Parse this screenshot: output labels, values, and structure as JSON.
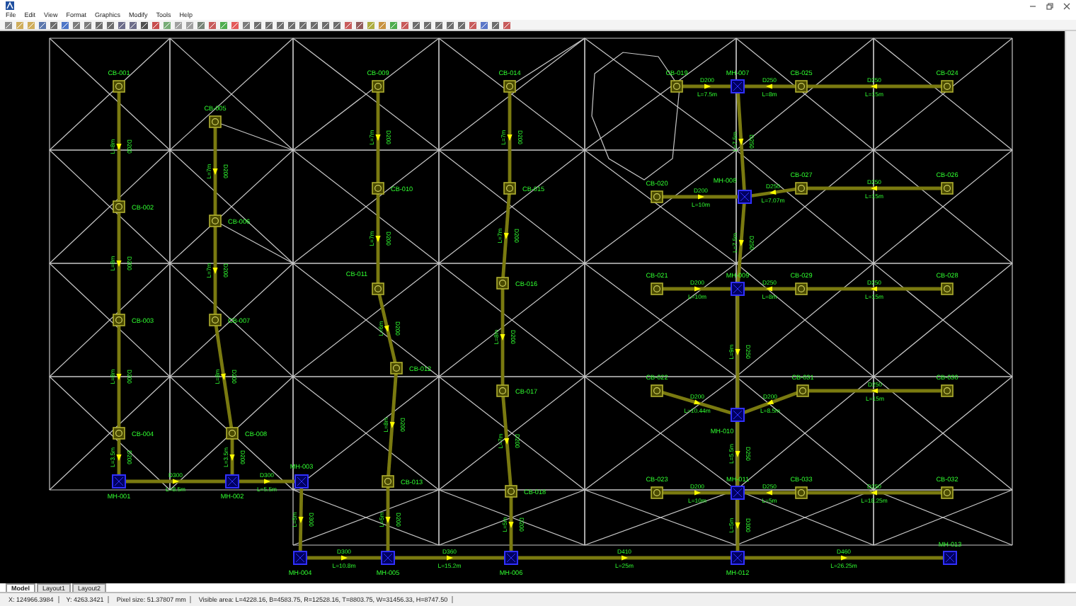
{
  "menu": [
    "File",
    "Edit",
    "View",
    "Format",
    "Graphics",
    "Modify",
    "Tools",
    "Help"
  ],
  "nodes": [
    {
      "label": "CB-001",
      "kind": "catch_basin"
    },
    {
      "label": "CB-002",
      "kind": "catch_basin"
    },
    {
      "label": "CB-003",
      "kind": "catch_basin"
    },
    {
      "label": "CB-004",
      "kind": "catch_basin"
    },
    {
      "label": "MH-001",
      "kind": "manhole"
    },
    {
      "label": "CB-005",
      "kind": "catch_basin"
    },
    {
      "label": "CB-006",
      "kind": "catch_basin"
    },
    {
      "label": "CB-007",
      "kind": "catch_basin"
    },
    {
      "label": "CB-008",
      "kind": "catch_basin"
    },
    {
      "label": "MH-002",
      "kind": "manhole"
    },
    {
      "label": "MH-003",
      "kind": "manhole"
    },
    {
      "label": "MH-004",
      "kind": "manhole"
    },
    {
      "label": "CB-009",
      "kind": "catch_basin"
    },
    {
      "label": "CB-010",
      "kind": "catch_basin"
    },
    {
      "label": "CB-011",
      "kind": "catch_basin"
    },
    {
      "label": "CB-012",
      "kind": "catch_basin"
    },
    {
      "label": "CB-013",
      "kind": "catch_basin"
    },
    {
      "label": "MH-005",
      "kind": "manhole"
    },
    {
      "label": "CB-014",
      "kind": "catch_basin"
    },
    {
      "label": "CB-015",
      "kind": "catch_basin"
    },
    {
      "label": "CB-016",
      "kind": "catch_basin"
    },
    {
      "label": "CB-017",
      "kind": "catch_basin"
    },
    {
      "label": "CB-018",
      "kind": "catch_basin"
    },
    {
      "label": "MH-006",
      "kind": "manhole"
    },
    {
      "label": "CB-019",
      "kind": "catch_basin"
    },
    {
      "label": "MH-007",
      "kind": "manhole"
    },
    {
      "label": "CB-025",
      "kind": "catch_basin"
    },
    {
      "label": "CB-024",
      "kind": "catch_basin"
    },
    {
      "label": "CB-020",
      "kind": "catch_basin"
    },
    {
      "label": "MH-008",
      "kind": "manhole"
    },
    {
      "label": "CB-027",
      "kind": "catch_basin"
    },
    {
      "label": "CB-026",
      "kind": "catch_basin"
    },
    {
      "label": "CB-021",
      "kind": "catch_basin"
    },
    {
      "label": "MH-009",
      "kind": "manhole"
    },
    {
      "label": "CB-029",
      "kind": "catch_basin"
    },
    {
      "label": "CB-028",
      "kind": "catch_basin"
    },
    {
      "label": "CB-022",
      "kind": "catch_basin"
    },
    {
      "label": "MH-010",
      "kind": "manhole"
    },
    {
      "label": "CB-031",
      "kind": "catch_basin"
    },
    {
      "label": "CB-030",
      "kind": "catch_basin"
    },
    {
      "label": "CB-023",
      "kind": "catch_basin"
    },
    {
      "label": "MH-011",
      "kind": "manhole"
    },
    {
      "label": "CB-033",
      "kind": "catch_basin"
    },
    {
      "label": "CB-032",
      "kind": "catch_basin"
    },
    {
      "label": "MH-012",
      "kind": "manhole"
    },
    {
      "label": "MH-013",
      "kind": "manhole"
    }
  ],
  "pipes": [
    {
      "diameter": "D200",
      "length": "L=8m"
    },
    {
      "diameter": "D200",
      "length": "L=8m"
    },
    {
      "diameter": "D200",
      "length": "L=8m"
    },
    {
      "diameter": "D200",
      "length": "L=3.5m"
    },
    {
      "diameter": "D200",
      "length": "L=7m"
    },
    {
      "diameter": "D200",
      "length": "L=7m"
    },
    {
      "diameter": "D200",
      "length": "L=8m"
    },
    {
      "diameter": "D200",
      "length": "L=3.5m"
    },
    {
      "diameter": "D300",
      "length": "L=8.5m"
    },
    {
      "diameter": "D300",
      "length": "L=5.5m"
    },
    {
      "diameter": "D300",
      "length": "L=5m"
    },
    {
      "diameter": "D200",
      "length": "L=7m"
    },
    {
      "diameter": "D200",
      "length": "L=7m"
    },
    {
      "diameter": "D200",
      "length": "L=6m"
    },
    {
      "diameter": "D200",
      "length": "L=8m"
    },
    {
      "diameter": "D200",
      "length": "L=5m"
    },
    {
      "diameter": "D200",
      "length": "L=7m"
    },
    {
      "diameter": "D200",
      "length": "L=7m"
    },
    {
      "diameter": "D200",
      "length": "L=8m"
    },
    {
      "diameter": "D200",
      "length": "L=7m"
    },
    {
      "diameter": "D200",
      "length": "L=5m"
    },
    {
      "diameter": "D300",
      "length": "L=10.8m"
    },
    {
      "diameter": "D360",
      "length": "L=15.2m"
    },
    {
      "diameter": "D410",
      "length": "L=25m"
    },
    {
      "diameter": "D460",
      "length": "L=26.25m"
    },
    {
      "diameter": "D200",
      "length": "L=7.5m"
    },
    {
      "diameter": "D250",
      "length": "L=8m"
    },
    {
      "diameter": "D250",
      "length": "L=15m"
    },
    {
      "diameter": "D250",
      "length": "L=7.5m"
    },
    {
      "diameter": "D200",
      "length": "L=10m"
    },
    {
      "diameter": "D250",
      "length": "L=7.07m"
    },
    {
      "diameter": "D250",
      "length": "L=15m"
    },
    {
      "diameter": "D250",
      "length": "L=7.5m"
    },
    {
      "diameter": "D200",
      "length": "L=10m"
    },
    {
      "diameter": "D250",
      "length": "L=8m"
    },
    {
      "diameter": "D250",
      "length": "L=15m"
    },
    {
      "diameter": "D250",
      "length": "L=9m"
    },
    {
      "diameter": "D200",
      "length": "L=10.44m"
    },
    {
      "diameter": "D200",
      "length": "L=8.5m"
    },
    {
      "diameter": "D250",
      "length": "L=15m"
    },
    {
      "diameter": "D250",
      "length": "L=5.5m"
    },
    {
      "diameter": "D200",
      "length": "L=10m"
    },
    {
      "diameter": "D250",
      "length": "L=5m"
    },
    {
      "diameter": "D250",
      "length": "L=18.25m"
    },
    {
      "diameter": "D300",
      "length": "L=5m"
    }
  ],
  "layout_tabs": [
    {
      "label": "Model",
      "selected": true
    },
    {
      "label": "Layout1",
      "selected": false
    },
    {
      "label": "Layout2",
      "selected": false
    }
  ],
  "status_bar": [
    "X: 124966.3984",
    "Y: 4263.3421",
    "Pixel size: 51.37807 mm",
    "Visible area: L=4228.16, B=4583.75, R=12528.16, T=8803.75, W=31456.33, H=8747.50"
  ]
}
